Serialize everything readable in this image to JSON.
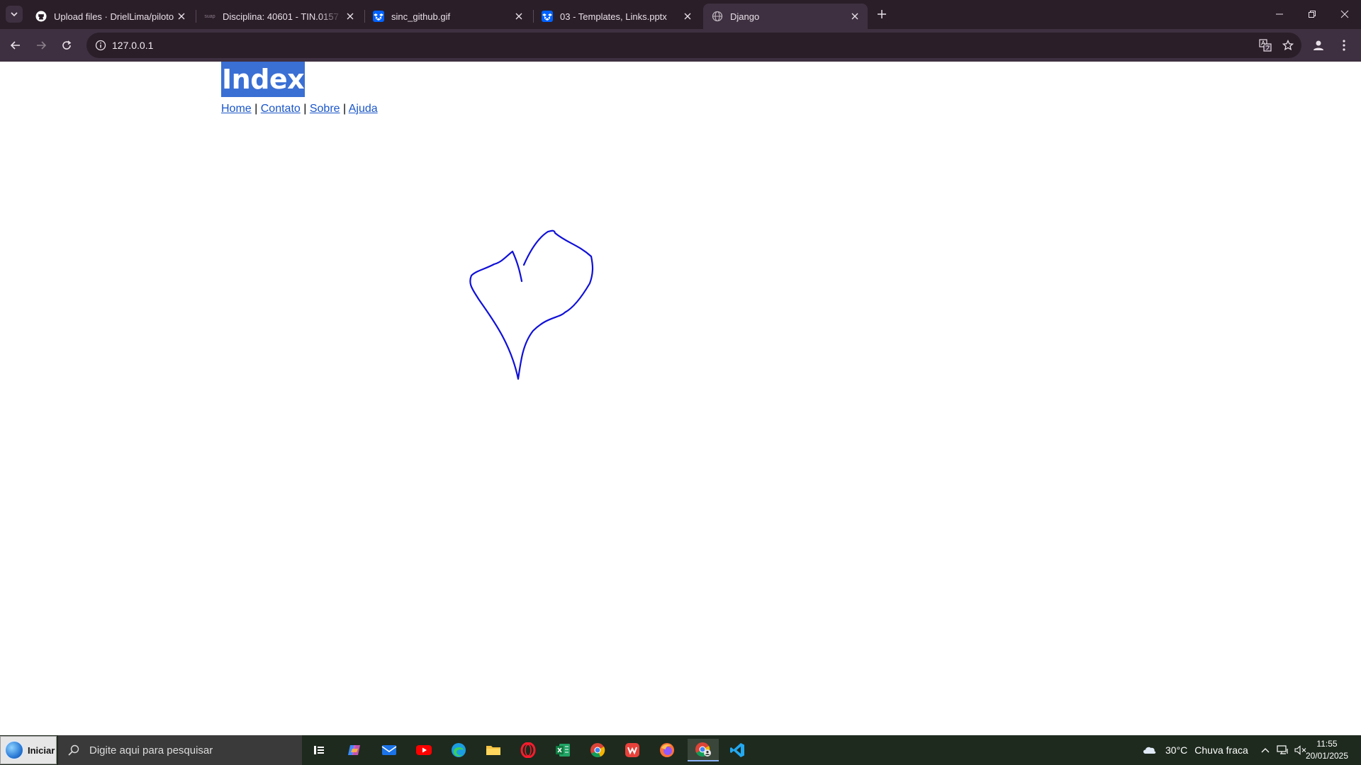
{
  "browser": {
    "tabs": [
      {
        "title": "Upload files · DrielLima/piloto",
        "favicon": "github-icon"
      },
      {
        "title": "Disciplina: 40601 - TIN.0157 - P",
        "favicon": "suap-icon"
      },
      {
        "title": "sinc_github.gif",
        "favicon": "dropbox-icon"
      },
      {
        "title": "03 - Templates, Links.pptx",
        "favicon": "dropbox-icon"
      },
      {
        "title": "Django",
        "favicon": "globe-icon",
        "active": true
      }
    ],
    "url": "127.0.0.1",
    "suap_favicon_text": "suap"
  },
  "page": {
    "heading": "Index",
    "links": [
      "Home",
      "Contato",
      "Sobre",
      "Ajuda"
    ],
    "separator": "|",
    "drawing_color": "#1010d8"
  },
  "taskbar": {
    "start_label": "Iniciar",
    "search_placeholder": "Digite aqui para pesquisar",
    "weather": {
      "temp": "30°C",
      "desc": "Chuva fraca"
    },
    "time": "11:55",
    "date": "20/01/2025",
    "apps": [
      "task-view-icon",
      "copilot-icon",
      "mail-icon",
      "youtube-icon",
      "edge-icon",
      "file-explorer-icon",
      "opera-icon",
      "excel-icon",
      "chrome-icon",
      "wps-icon",
      "firefox-icon",
      "chrome-profile-icon",
      "vscode-icon"
    ]
  }
}
